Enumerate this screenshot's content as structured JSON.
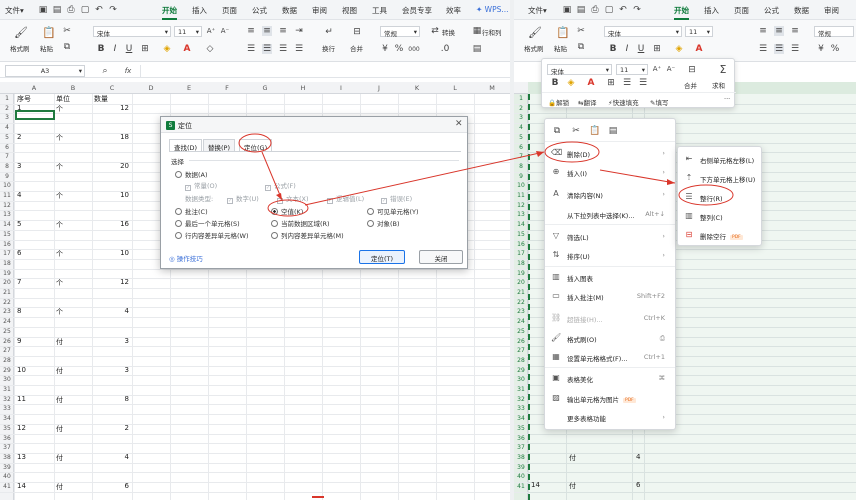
{
  "left": {
    "menu": [
      "文件",
      "开始",
      "插入",
      "页面",
      "公式",
      "数据",
      "审阅",
      "视图",
      "工具",
      "会员专享",
      "效率"
    ],
    "menu_active": "开始",
    "wps_ai": "WPS...",
    "ribbon": {
      "format_painter": "格式刷",
      "paste": "粘贴",
      "font": "宋体",
      "size": "11",
      "wrap": "换行",
      "merge": "合并",
      "number_format": "常规",
      "convert": "转换",
      "rows_cols": "行和列"
    },
    "namebox": "A3",
    "fx": "fx",
    "columns": [
      "A",
      "B",
      "C",
      "D",
      "E",
      "F",
      "G",
      "H",
      "I",
      "J",
      "K",
      "L",
      "M"
    ],
    "rows": [
      "1",
      "2",
      "3",
      "4",
      "5",
      "6",
      "7",
      "8",
      "9",
      "10",
      "11",
      "12",
      "13",
      "14",
      "15",
      "16",
      "17",
      "18",
      "19",
      "20",
      "21",
      "22",
      "23",
      "24",
      "25",
      "26",
      "27",
      "28",
      "29",
      "30",
      "31",
      "32",
      "33",
      "34",
      "35",
      "36",
      "37",
      "38",
      "39",
      "40",
      "41"
    ],
    "headers": {
      "a": "序号",
      "b": "单位",
      "c": "数量"
    },
    "data": [
      {
        "a": "1",
        "b": "个",
        "c": "12"
      },
      {
        "a": "2",
        "b": "个",
        "c": "18"
      },
      {
        "a": "3",
        "b": "个",
        "c": "20"
      },
      {
        "a": "4",
        "b": "个",
        "c": "10"
      },
      {
        "a": "5",
        "b": "个",
        "c": "16"
      },
      {
        "a": "6",
        "b": "个",
        "c": "10"
      },
      {
        "a": "7",
        "b": "个",
        "c": "12"
      },
      {
        "a": "8",
        "b": "个",
        "c": "4"
      },
      {
        "a": "9",
        "b": "付",
        "c": "3"
      },
      {
        "a": "10",
        "b": "付",
        "c": "3"
      },
      {
        "a": "11",
        "b": "付",
        "c": "8"
      },
      {
        "a": "12",
        "b": "付",
        "c": "2"
      },
      {
        "a": "13",
        "b": "付",
        "c": "4"
      },
      {
        "a": "14",
        "b": "付",
        "c": "6"
      }
    ]
  },
  "dialog": {
    "title": "定位",
    "tabs": [
      "查找(D)",
      "替换(P)",
      "定位(G)"
    ],
    "section": "选择",
    "data_label": "数据(A)",
    "const": "常量(O)",
    "formula": "公式(F)",
    "data_type": "数据类型:",
    "number": "数字(U)",
    "text": "文本(X)",
    "logic": "逻辑值(L)",
    "error": "错误(E)",
    "comment": "批注(C)",
    "blank": "空值(K)",
    "visible": "可见单元格(Y)",
    "last_cell": "最后一个单元格(S)",
    "current_region": "当前数据区域(R)",
    "object": "对象(B)",
    "row_diff": "行内容差异单元格(W)",
    "col_diff": "列内容差异单元格(M)",
    "tips": "操作技巧",
    "ok": "定位(T)",
    "close": "关闭"
  },
  "right": {
    "menu": [
      "文件",
      "开始",
      "插入",
      "页面",
      "公式",
      "数据",
      "审阅"
    ],
    "menu_active": "开始",
    "ribbon": {
      "format_painter": "格式刷",
      "paste": "粘贴",
      "font": "宋体",
      "size": "11",
      "number_format": "常规",
      "wrap": "换行",
      "merge": "合并"
    },
    "rows": [
      "1",
      "2",
      "3",
      "4",
      "5",
      "6",
      "7",
      "8",
      "9",
      "10",
      "11",
      "12",
      "13",
      "14",
      "15",
      "16",
      "17",
      "18",
      "19",
      "20",
      "21",
      "22",
      "23",
      "24",
      "25",
      "26",
      "27",
      "28",
      "29",
      "30",
      "31",
      "32",
      "33",
      "34",
      "35",
      "36",
      "37",
      "38",
      "39",
      "40",
      "41"
    ],
    "row13": {
      "b": "付",
      "c": "4"
    },
    "row14": {
      "a": "14",
      "b": "付",
      "c": "6"
    }
  },
  "mini_toolbar": {
    "font": "宋体",
    "size": "11",
    "merge": "合并",
    "autosum": "求和",
    "unlock": "解锁",
    "translate": "翻译",
    "quick_fill": "快速填充",
    "fill": "填写"
  },
  "context_menu": {
    "items": [
      {
        "label": "删除(D)",
        "shortcut": ""
      },
      {
        "label": "插入(I)",
        "shortcut": ""
      },
      {
        "label": "清除内容(N)",
        "shortcut": ""
      },
      {
        "label": "从下拉列表中选择(K)...",
        "shortcut": "Alt+↓"
      },
      {
        "label": "筛选(L)",
        "shortcut": ""
      },
      {
        "label": "排序(U)",
        "shortcut": ""
      },
      {
        "label": "插入图表",
        "shortcut": ""
      },
      {
        "label": "插入批注(M)",
        "shortcut": "Shift+F2"
      },
      {
        "label": "超链接(H)...",
        "shortcut": "Ctrl+K"
      },
      {
        "label": "格式刷(O)",
        "shortcut": ""
      },
      {
        "label": "设置单元格格式(F)...",
        "shortcut": "Ctrl+1"
      },
      {
        "label": "表格美化",
        "shortcut": ""
      },
      {
        "label": "输出单元格为图片",
        "shortcut": ""
      },
      {
        "label": "更多表格功能",
        "shortcut": ""
      }
    ]
  },
  "submenu": {
    "items": [
      "右侧单元格左移(L)",
      "下方单元格上移(U)",
      "整行(R)",
      "整列(C)",
      "删除空行"
    ]
  },
  "badge": "PDF",
  "colors": {
    "accent": "#0f7b3c",
    "annotation": "#d9362b",
    "select": "#1f7a3f"
  }
}
